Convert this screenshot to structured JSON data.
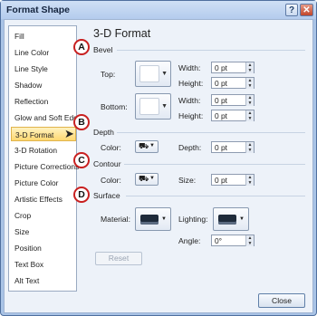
{
  "window": {
    "title": "Format Shape",
    "help": "?",
    "close_glyph": "✕"
  },
  "sidebar": {
    "items": [
      {
        "label": "Fill"
      },
      {
        "label": "Line Color"
      },
      {
        "label": "Line Style"
      },
      {
        "label": "Shadow"
      },
      {
        "label": "Reflection"
      },
      {
        "label": "Glow and Soft Edges"
      },
      {
        "label": "3-D Format",
        "selected": true
      },
      {
        "label": "3-D Rotation"
      },
      {
        "label": "Picture Corrections"
      },
      {
        "label": "Picture Color"
      },
      {
        "label": "Artistic Effects"
      },
      {
        "label": "Crop"
      },
      {
        "label": "Size"
      },
      {
        "label": "Position"
      },
      {
        "label": "Text Box"
      },
      {
        "label": "Alt Text"
      }
    ]
  },
  "panel": {
    "title": "3-D Format",
    "bevel": {
      "label": "Bevel",
      "top": "Top:",
      "bottom": "Bottom:",
      "top_width_label": "Width:",
      "top_width": "0 pt",
      "top_height_label": "Height:",
      "top_height": "0 pt",
      "bottom_width_label": "Width:",
      "bottom_width": "0 pt",
      "bottom_height_label": "Height:",
      "bottom_height": "0 pt"
    },
    "depth": {
      "label": "Depth",
      "color": "Color:",
      "depth_label": "Depth:",
      "depth_value": "0 pt"
    },
    "contour": {
      "label": "Contour",
      "color": "Color:",
      "size_label": "Size:",
      "size_value": "0 pt"
    },
    "surface": {
      "label": "Surface",
      "material": "Material:",
      "lighting": "Lighting:",
      "angle_label": "Angle:",
      "angle_value": "0°"
    },
    "reset": "Reset"
  },
  "callouts": {
    "a": "A",
    "b": "B",
    "c": "C",
    "d": "D"
  },
  "footer": {
    "close": "Close"
  },
  "colors": {
    "callout_border": "#c82020",
    "selected_item": "#ffd871"
  }
}
